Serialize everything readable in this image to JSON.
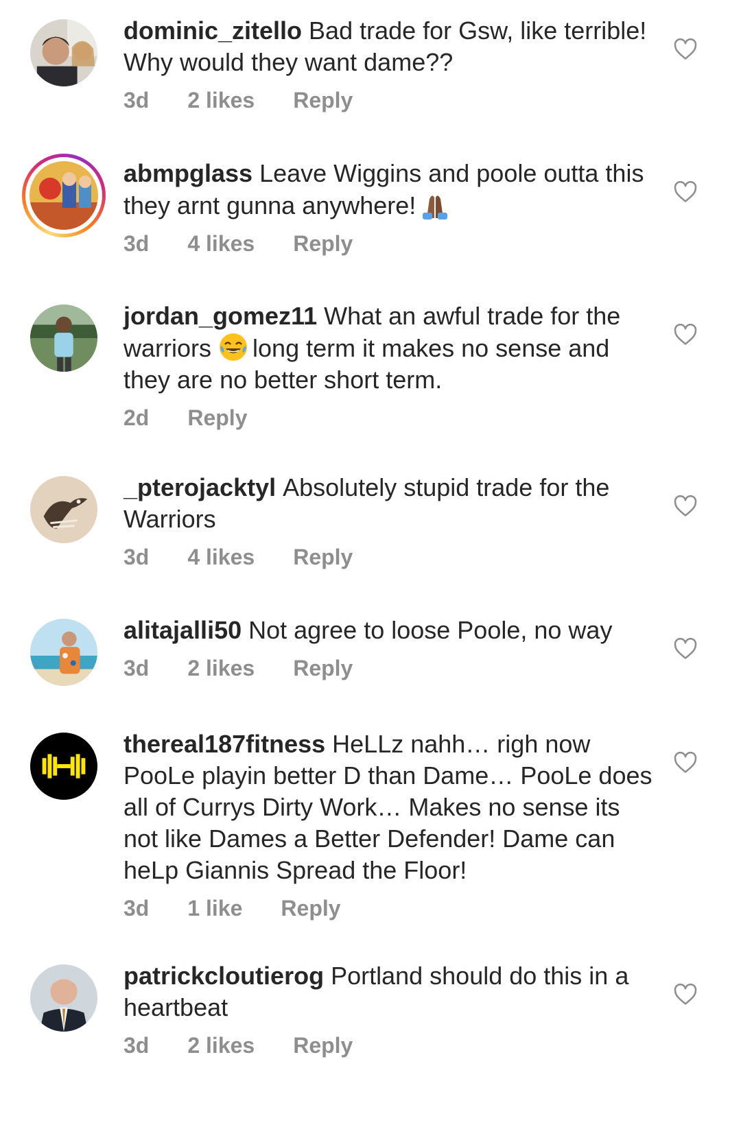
{
  "comments": [
    {
      "username": "dominic_zitello",
      "text": "Bad trade for Gsw, like terrible! Why would they want dame??",
      "time": "3d",
      "likes": "2 likes",
      "reply": "Reply"
    },
    {
      "username": "abmpglass",
      "text": "Leave Wiggins and poole outta this they arnt gunna anywhere!",
      "emoji": "folded-hands-emoji",
      "time": "3d",
      "likes": "4 likes",
      "reply": "Reply"
    },
    {
      "username": "jordan_gomez11",
      "text_a": "What an awful trade for the warriors",
      "emoji": "tears-of-joy-emoji",
      "text_b": "long term it makes no sense and they are no better short term.",
      "time": "2d",
      "reply": "Reply"
    },
    {
      "username": "_pterojacktyl",
      "text": "Absolutely stupid trade for the Warriors",
      "time": "3d",
      "likes": "4 likes",
      "reply": "Reply"
    },
    {
      "username": "alitajalli50",
      "text": "Not agree to loose Poole, no way",
      "time": "3d",
      "likes": "2 likes",
      "reply": "Reply"
    },
    {
      "username": "thereal187fitness",
      "text": "HeLLz nahh… righ now PooLe playin better D than Dame… PooLe does all of Currys Dirty Work… Makes no sense its not like Dames a Better Defender! Dame can heLp Giannis Spread the Floor!",
      "time": "3d",
      "likes": "1 like",
      "reply": "Reply"
    },
    {
      "username": "patrickcloutierog",
      "text": "Portland should do this in a heartbeat",
      "time": "3d",
      "likes": "2 likes",
      "reply": "Reply"
    }
  ],
  "icons": {
    "like": "heart-outline-icon"
  },
  "colors": {
    "text": "#262626",
    "meta": "#8e8e8e",
    "story_ring": [
      "#feda75",
      "#fa7e1e",
      "#d62976",
      "#962fbf"
    ]
  }
}
